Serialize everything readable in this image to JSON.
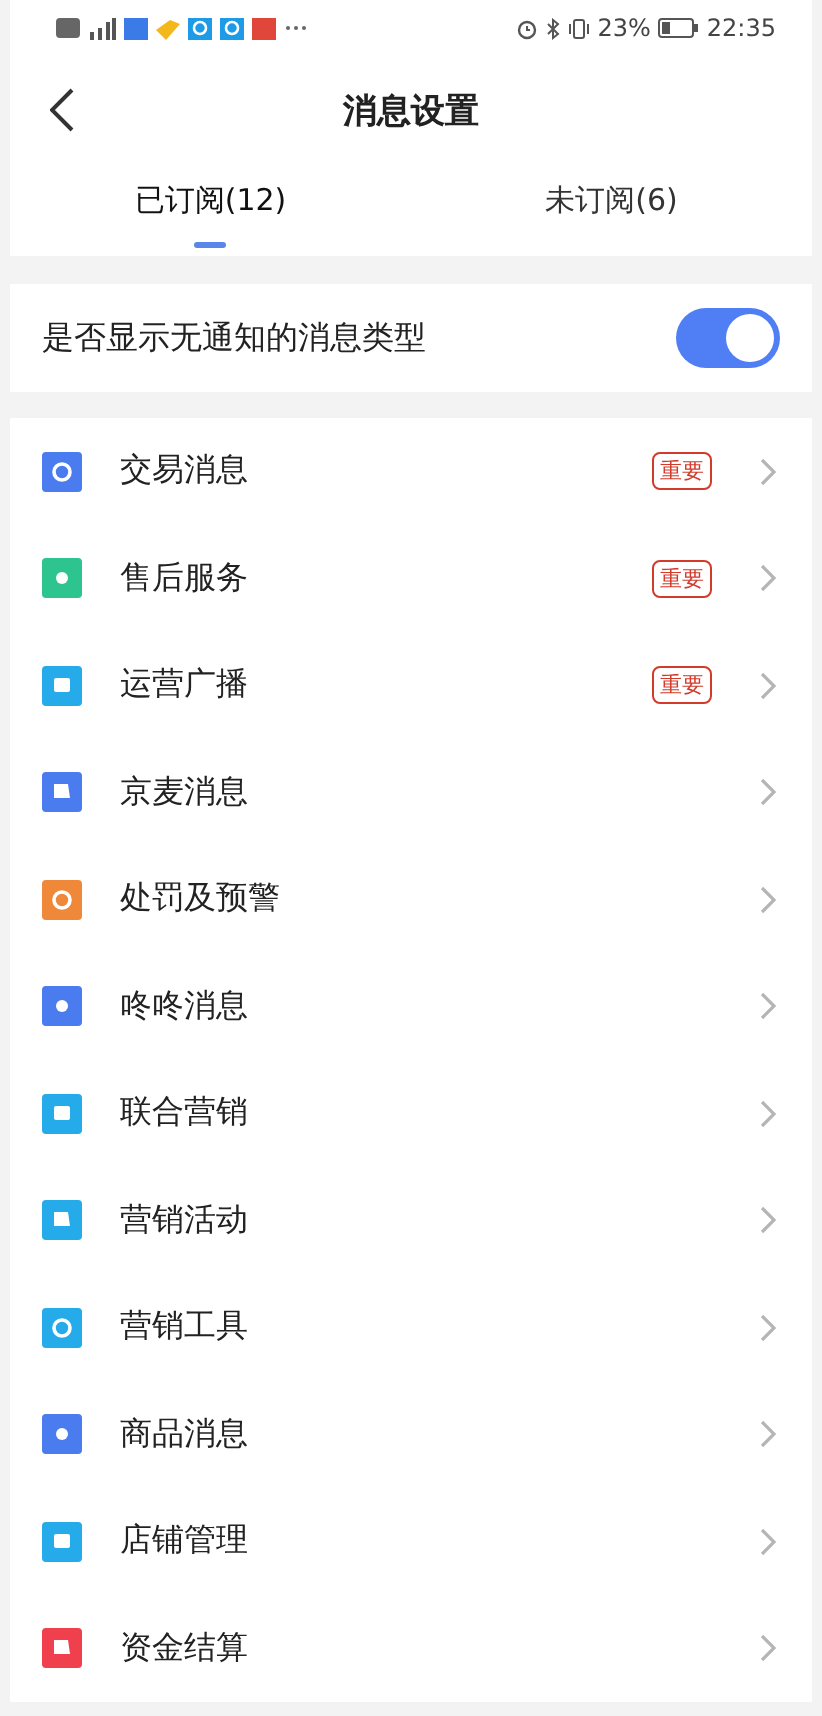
{
  "status_bar": {
    "battery": "23%",
    "time": "22:35"
  },
  "header": {
    "title": "消息设置"
  },
  "tabs": [
    {
      "label": "已订阅(12)",
      "selected": true
    },
    {
      "label": "未订阅(6)",
      "selected": false
    }
  ],
  "toggle_row": {
    "label": "是否显示无通知的消息类型",
    "on": true
  },
  "items": [
    {
      "label": "交易消息",
      "color": "#4a7cf0",
      "badge": "重要"
    },
    {
      "label": "售后服务",
      "color": "#2ec48f",
      "badge": "重要"
    },
    {
      "label": "运营广播",
      "color": "#25aaea",
      "badge": "重要"
    },
    {
      "label": "京麦消息",
      "color": "#4a7cf0"
    },
    {
      "label": "处罚及预警",
      "color": "#f0883a"
    },
    {
      "label": "咚咚消息",
      "color": "#4a7cf0"
    },
    {
      "label": "联合营销",
      "color": "#25aaea"
    },
    {
      "label": "营销活动",
      "color": "#25aaea"
    },
    {
      "label": "营销工具",
      "color": "#25aaea"
    },
    {
      "label": "商品消息",
      "color": "#4a7cf0"
    },
    {
      "label": "店铺管理",
      "color": "#25aaea"
    },
    {
      "label": "资金结算",
      "color": "#f0404e"
    }
  ]
}
